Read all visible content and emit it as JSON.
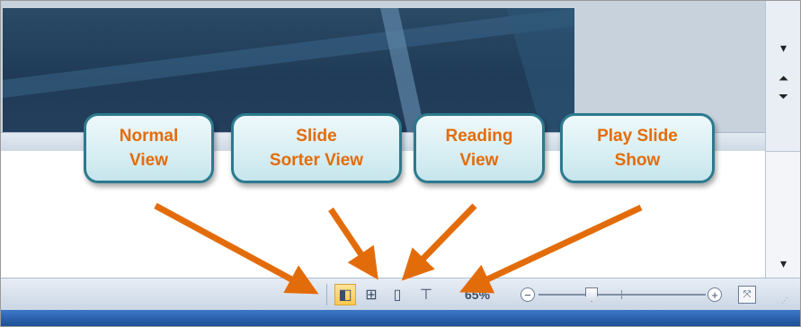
{
  "callouts": {
    "normal": [
      "Normal",
      "View"
    ],
    "sorter": [
      "Slide",
      "Sorter View"
    ],
    "reading": [
      "Reading",
      "View"
    ],
    "slideshow": [
      "Play Slide",
      "Show"
    ]
  },
  "statusbar": {
    "zoom_percent": "65%",
    "zoom_minus": "−",
    "zoom_plus": "+"
  },
  "colors": {
    "callout_text": "#e36c0a",
    "callout_border": "#2c7a8e",
    "arrow": "#e36c0a"
  }
}
